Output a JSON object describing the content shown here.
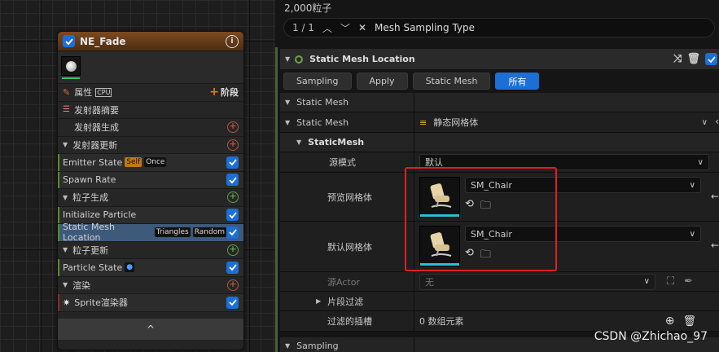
{
  "graph": {
    "node_title": "NE_Fade",
    "rows": [
      {
        "label": "属性",
        "kind": "props",
        "chip": "CPU",
        "action": "阶段"
      },
      {
        "label": "发射器摘要",
        "kind": "summary"
      },
      {
        "label": "发射器生成",
        "kind": "indent-plus-red"
      },
      {
        "label": "发射器更新",
        "kind": "section-plus-red"
      },
      {
        "label": "Emitter State",
        "kind": "module-green",
        "tags": [
          "Self",
          "Once"
        ]
      },
      {
        "label": "Spawn Rate",
        "kind": "module-green"
      },
      {
        "label": "粒子生成",
        "kind": "section-plus-green"
      },
      {
        "label": "Initialize Particle",
        "kind": "module-green"
      },
      {
        "label": "Static Mesh Location",
        "kind": "module-selected",
        "tags": [
          "Triangles",
          "Random"
        ]
      },
      {
        "label": "粒子更新",
        "kind": "section-plus-green"
      },
      {
        "label": "Particle State",
        "kind": "module-green",
        "tags": [
          "●"
        ]
      },
      {
        "label": "渲染",
        "kind": "section-plus-red"
      },
      {
        "label": "Sprite渲染器",
        "kind": "module-red"
      }
    ],
    "collapse_glyph": "^"
  },
  "details": {
    "particle_count": "2,000粒子",
    "search": {
      "counter": "1 / 1",
      "query": "Mesh Sampling Type"
    },
    "section_title": "Static Mesh Location",
    "tabs": [
      "Sampling",
      "Apply",
      "Static Mesh",
      "所有"
    ],
    "active_tab": "所有",
    "rows": {
      "static_mesh_group": "Static Mesh",
      "static_mesh_label": "Static Mesh",
      "static_mesh_value": "静态网格体",
      "staticmesh_struct": "StaticMesh",
      "source_mode_label": "源模式",
      "source_mode_value": "默认",
      "preview_mesh_label": "预览网格体",
      "preview_mesh_value": "SM_Chair",
      "default_mesh_label": "默认网格体",
      "default_mesh_value": "SM_Chair",
      "source_actor_label": "源Actor",
      "source_actor_value": "无",
      "section_filter_label": "片段过滤",
      "filtered_slots_label": "过滤的插槽",
      "filtered_slots_value": "0 数组元素",
      "sampling_group": "Sampling"
    }
  },
  "watermark": "CSDN @Zhichao_97",
  "colors": {
    "accent": "#1c6fd6",
    "highlight_box": "#e02020",
    "node_header": "#7c4a20"
  }
}
